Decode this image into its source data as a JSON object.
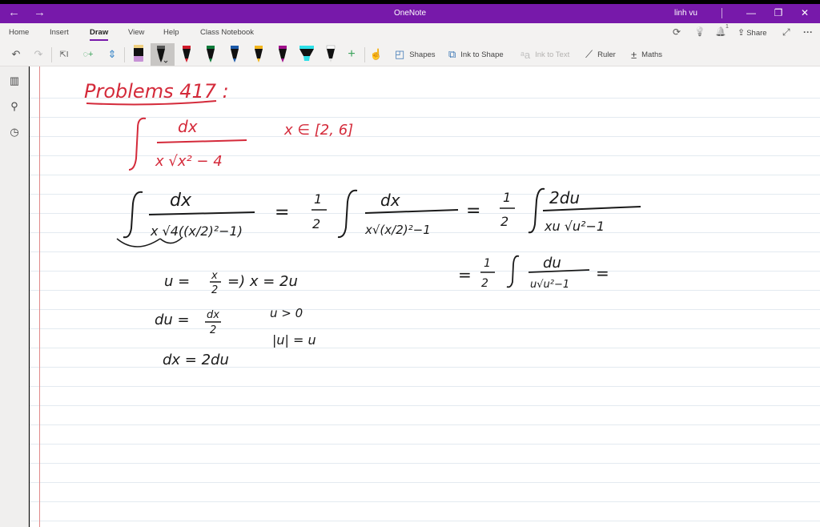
{
  "window": {
    "title": "OneNote",
    "user": "linh vu",
    "back_icon": "←",
    "forward_icon": "→",
    "minimize_icon": "—",
    "restore_icon": "❐",
    "close_icon": "✕"
  },
  "ribbon": {
    "tabs": [
      "Home",
      "Insert",
      "Draw",
      "View",
      "Help",
      "Class Notebook"
    ],
    "active_tab": "Draw",
    "right": {
      "sync_icon": "⟳",
      "tips_icon": "💡",
      "notifications_icon": "🔔",
      "notifications_count": "1",
      "share_label": "Share",
      "fullscreen_icon": "⤢",
      "more_icon": "···"
    },
    "tools": {
      "undo_icon": "↶",
      "redo_icon": "↷",
      "lasso_text_icon": "⇱I",
      "lasso_select_icon": "◌+",
      "add_space_icon": "⇕",
      "pens": [
        {
          "name": "eraser",
          "color": "#c792d6",
          "top": "#f0d080"
        },
        {
          "name": "pen-black",
          "color": "#111111",
          "selected": true
        },
        {
          "name": "pen-red",
          "color": "#d01c2b"
        },
        {
          "name": "pen-green",
          "color": "#0f7b3a"
        },
        {
          "name": "pen-blue",
          "color": "#1c5aa8"
        },
        {
          "name": "pen-yellow",
          "color": "#f2b51c"
        },
        {
          "name": "pen-magenta",
          "color": "#a0108c"
        },
        {
          "name": "highlighter-cyan",
          "color": "#2ee0e8"
        },
        {
          "name": "pen-white",
          "color": "#ffffff"
        }
      ],
      "add_pen_icon": "+",
      "touch_draw_icon": "☝",
      "shapes_label": "Shapes",
      "ink_to_shape_label": "Ink to Shape",
      "ink_to_text_label": "Ink to Text",
      "ruler_label": "Ruler",
      "maths_label": "Maths"
    }
  },
  "sidebar": {
    "notebooks_icon": "▥",
    "search_icon": "⚲",
    "recent_icon": "◷"
  },
  "ink": {
    "title": "Problems 417 :",
    "problem_integrand": "∫ dx / (x√(x²−4))",
    "domain": "x ∈ [2, 6]",
    "step1_lhs": "∫ dx / (x√(4((x/2)²−1)))",
    "step1_mid": "= ½ ∫ dx / (x√((x/2)²−1))",
    "step1_rhs": "= ½ ∫ 2du / (xu√(u²−1))",
    "step2": "= ½ ∫ du / (u√(u²−1)) =",
    "sub1": "u = x/2 ⇒ x = 2u",
    "sub2": "du = dx/2",
    "sub3": "dx = 2du",
    "cond1": "u > 0",
    "cond2": "|u| = u"
  }
}
